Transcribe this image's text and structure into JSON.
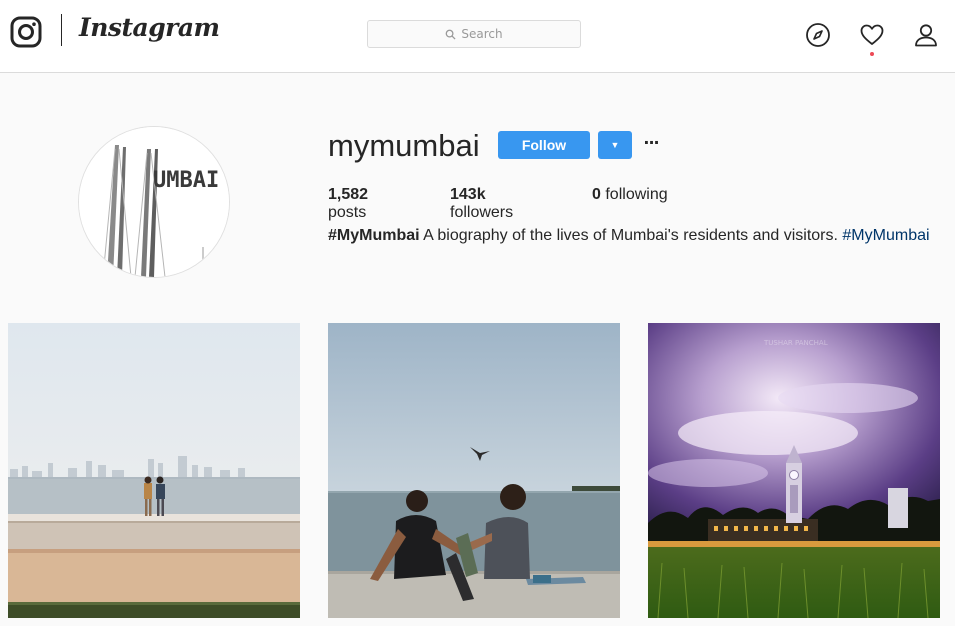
{
  "app": {
    "wordmark": "Instagram"
  },
  "search": {
    "placeholder": "Search"
  },
  "profile": {
    "username": "mymumbai",
    "avatar_text": "UMBAI",
    "follow_label": "Follow",
    "more_label": "···",
    "stats": {
      "posts_count": "1,582",
      "posts_label": "posts",
      "followers_count": "143k",
      "followers_label": "followers",
      "following_count": "0",
      "following_label": "following"
    },
    "bio": {
      "hashtag_bold": "#MyMumbai",
      "text": " A biography of the lives of Mumbai's residents and visitors. ",
      "hashtag_link": "#MyMumbai"
    }
  },
  "posts": [
    {
      "alt": "Two children standing on the seawall looking at the Mumbai skyline across the sea"
    },
    {
      "alt": "Couple sitting on the seawall by the sea with a bird flying above"
    },
    {
      "alt": "Clock tower lit up at night under a purple sky with long-exposure clouds",
      "watermark": "TUSHAR PANCHAL"
    }
  ],
  "colors": {
    "accent": "#3897f0",
    "link": "#003569",
    "notification": "#ed4956"
  },
  "icons": [
    "instagram-logo-icon",
    "search-icon",
    "compass-icon",
    "heart-icon",
    "user-icon",
    "caret-down-icon"
  ]
}
